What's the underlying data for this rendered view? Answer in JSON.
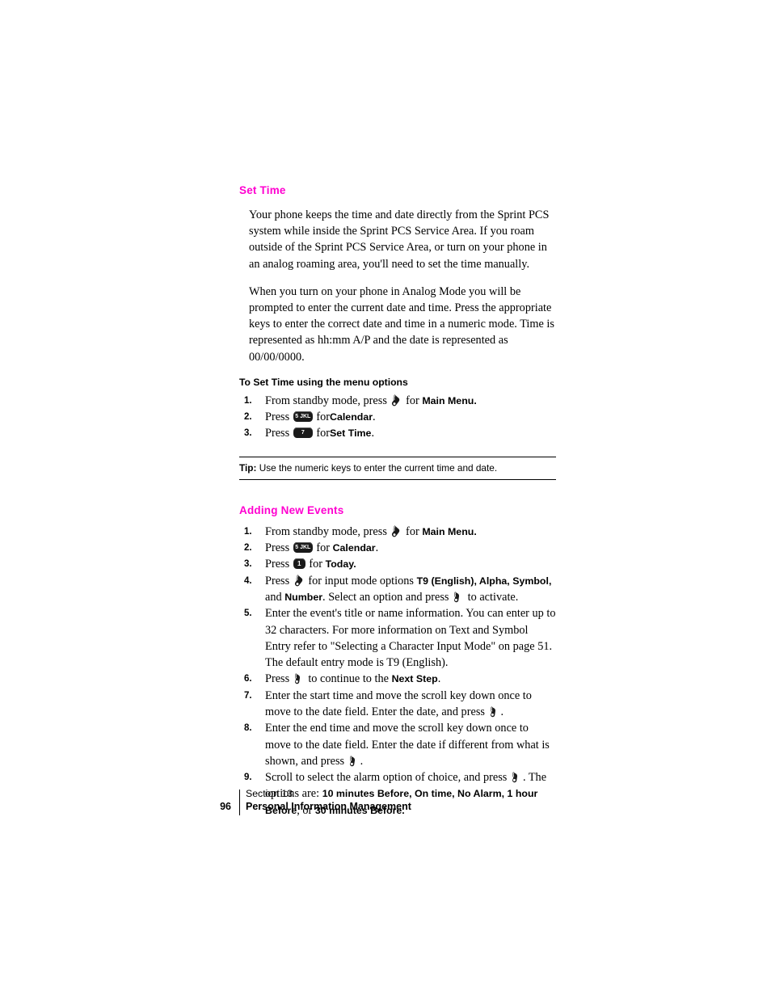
{
  "page": {
    "number": "96",
    "footer_section": "Section 13",
    "footer_section_name": "Personal Information Management",
    "accent_color": "#ff00d0"
  },
  "set_time": {
    "heading": "Set Time",
    "paragraph1": "Your phone keeps the time and date directly from the Sprint PCS system while inside the Sprint PCS Service Area. If you roam outside of the Sprint PCS Service Area, or turn on your phone in an analog roaming area, you'll need to set the time manually.",
    "paragraph2": "When you turn on your phone in Analog Mode you will be prompted to enter the current date and time. Press the appropriate keys to enter the correct date and time in a numeric mode. Time is represented as hh:mm A/P and the date is represented as 00/00/0000.",
    "subhead": "To Set Time using the menu options",
    "steps": [
      {
        "num": "1.",
        "pre": "From standby mode, press",
        "icon": "softkey-icon",
        "mid": "for",
        "bold": "Main Menu.",
        "post": ""
      },
      {
        "num": "2.",
        "pre": "Press",
        "icon": "key-5-jkl",
        "icon_label": "5 JKL",
        "mid": "for",
        "bold": "Calendar",
        "post": "."
      },
      {
        "num": "3.",
        "pre": "Press",
        "icon": "key-7-pqrs",
        "icon_label": "7 PQRS",
        "mid": "for",
        "bold": "Set Time",
        "post": "."
      }
    ],
    "tip_label": "Tip:",
    "tip_text": "Use the numeric keys to enter the current time and date."
  },
  "adding_new_events": {
    "heading": "Adding New Events",
    "steps": [
      {
        "num": "1.",
        "html": "From standby mode, press <span class=\"phkey\" data-name=\"softkey-icon\" data-interactable=\"false\"></span> for <span class=\"b\">Main Menu.</span>"
      },
      {
        "num": "2.",
        "html": "Press <span class=\"keycap\" data-name=\"key-5-jkl-icon\" data-interactable=\"false\"><span class=\"kd\">5 JKL</span></span> for <span class=\"b\">Calendar</span>."
      },
      {
        "num": "3.",
        "html": "Press <span class=\"keycap narrow\" data-name=\"key-1-icon\" data-interactable=\"false\"><span class=\"kd\">1</span></span> for <span class=\"b\">Today.</span>"
      },
      {
        "num": "4.",
        "html": "Press <span class=\"phkey\" data-name=\"softkey-icon\" data-interactable=\"false\"></span> for input mode options <span class=\"b\">T9 (English), Alpha, Symbol,</span> and <span class=\"b\">Number</span>. Select an option and press <span class=\"phkey\" data-name=\"select-key-icon\" data-interactable=\"false\"></span> to activate."
      },
      {
        "num": "5.",
        "html": "Enter the event's title or name information. You can enter up to 32 characters. For more information on Text and Symbol Entry refer to \"Selecting a Character Input Mode\" on page 51. The default entry mode is T9 (English)."
      },
      {
        "num": "6.",
        "html": "Press <span class=\"phkey\" data-name=\"select-key-icon\" data-interactable=\"false\"></span> to continue to the <span class=\"b\">Next Step</span>."
      },
      {
        "num": "7.",
        "html": "Enter the start time and move the scroll key down once to move to the date field. Enter the date, and press <span class=\"phkey\" data-name=\"select-key-icon\" data-interactable=\"false\"></span>."
      },
      {
        "num": "8.",
        "html": "Enter the end time and move the scroll key down once to move to the date field. Enter the date if different from what is shown, and press <span class=\"phkey\" data-name=\"select-key-icon\" data-interactable=\"false\"></span>."
      },
      {
        "num": "9.",
        "html": "Scroll to select the alarm option of choice, and press <span class=\"phkey\" data-name=\"select-key-icon\" data-interactable=\"false\"></span>. The options are: <span class=\"b\">10 minutes Before, On time, No Alarm, 1 hour Before</span>, or <span class=\"b\">30 minutes Before.</span>"
      }
    ]
  }
}
